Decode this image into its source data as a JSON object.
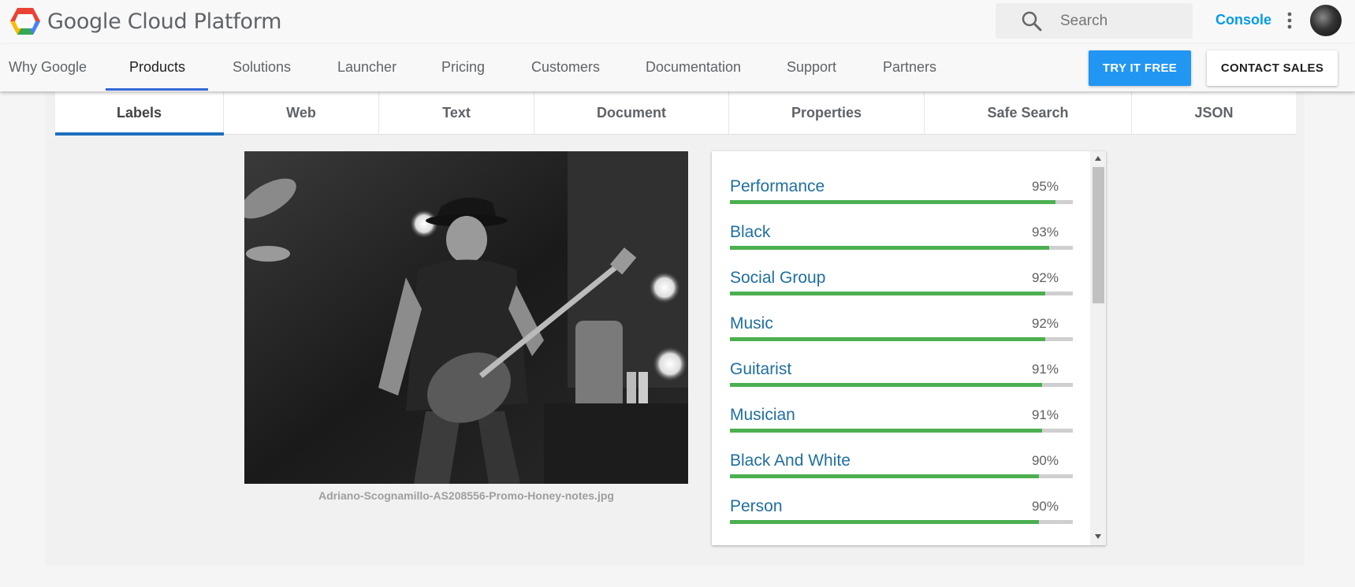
{
  "header": {
    "logo_text": "Google Cloud Platform",
    "search_placeholder": "Search",
    "console_label": "Console",
    "icons": [
      "gcp-logo-icon",
      "search-icon",
      "more-vert-icon",
      "avatar"
    ]
  },
  "nav": {
    "items": [
      {
        "label": "Why Google"
      },
      {
        "label": "Products"
      },
      {
        "label": "Solutions"
      },
      {
        "label": "Launcher"
      },
      {
        "label": "Pricing"
      },
      {
        "label": "Customers"
      },
      {
        "label": "Documentation"
      },
      {
        "label": "Support"
      },
      {
        "label": "Partners"
      }
    ],
    "active": "Products",
    "try_free_label": "TRY IT FREE",
    "contact_sales_label": "CONTACT SALES"
  },
  "tabs": {
    "items": [
      {
        "label": "Labels"
      },
      {
        "label": "Web"
      },
      {
        "label": "Text"
      },
      {
        "label": "Document"
      },
      {
        "label": "Properties"
      },
      {
        "label": "Safe Search"
      },
      {
        "label": "JSON"
      }
    ],
    "active": "Labels"
  },
  "image": {
    "filename": "Adriano-Scognamillo-AS208556-Promo-Honey-notes.jpg"
  },
  "labels": [
    {
      "name": "Performance",
      "score": "95%",
      "value": 95
    },
    {
      "name": "Black",
      "score": "93%",
      "value": 93
    },
    {
      "name": "Social Group",
      "score": "92%",
      "value": 92
    },
    {
      "name": "Music",
      "score": "92%",
      "value": 92
    },
    {
      "name": "Guitarist",
      "score": "91%",
      "value": 91
    },
    {
      "name": "Musician",
      "score": "91%",
      "value": 91
    },
    {
      "name": "Black And White",
      "score": "90%",
      "value": 90
    },
    {
      "name": "Person",
      "score": "90%",
      "value": 90
    }
  ],
  "colors": {
    "accent_blue": "#2196f3",
    "label_text": "#1f6f9f",
    "bar_fill": "#4caf50",
    "tab_underline": "#1e6fbf"
  }
}
